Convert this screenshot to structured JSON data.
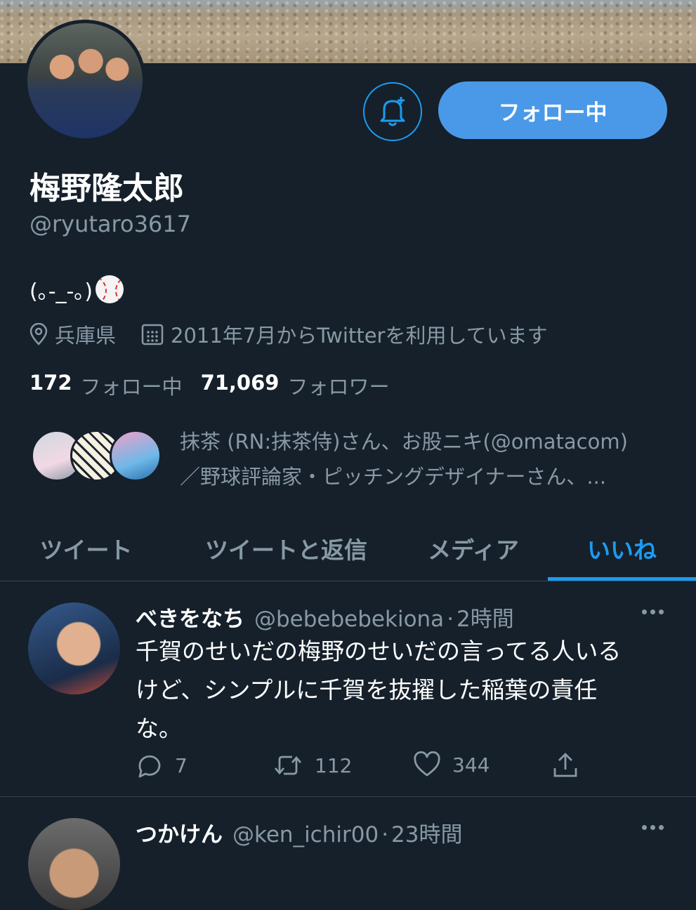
{
  "profile": {
    "name": "梅野隆太郎",
    "handle": "@ryutaro3617",
    "bio_text": "(｡-_-｡)",
    "location": "兵庫県",
    "joined": "2011年7月からTwitterを利用しています",
    "following_count": "172",
    "following_label": "フォロー中",
    "followers_count": "71,069",
    "followers_label": "フォロワー",
    "follow_button_label": "フォロー中",
    "known_followers_line1": "抹茶 (RN:抹茶侍)さん、お股ニキ(@omatacom)",
    "known_followers_line2": "／野球評論家・ピッチングデザイナーさん、..."
  },
  "tabs": [
    {
      "label": "ツイート"
    },
    {
      "label": "ツイートと返信"
    },
    {
      "label": "メディア"
    },
    {
      "label": "いいね"
    }
  ],
  "active_tab": "いいね",
  "tweets": [
    {
      "name": "べきをなち",
      "handle": "@bebebebekiona",
      "sep": "·",
      "time": "2時間",
      "text_line1": "千賀のせいだの梅野のせいだの言ってる人いる",
      "text_line2": "けど、シンプルに千賀を抜擢した稲葉の責任",
      "text_line3": "な。",
      "replies": "7",
      "retweets": "112",
      "likes": "344"
    },
    {
      "name": "つかけん",
      "handle": "@ken_ichir00",
      "sep": "·",
      "time": "23時間"
    }
  ],
  "colors": {
    "background": "#15202b",
    "accent": "#1d9bf0",
    "follow_button": "#4a99e9",
    "secondary_text": "#8899a6",
    "divider": "#38444d"
  },
  "icons": [
    "bell-plus-icon",
    "location-icon",
    "calendar-icon",
    "reply-icon",
    "retweet-icon",
    "like-icon",
    "share-icon",
    "more-icon",
    "baseball-emoji"
  ]
}
